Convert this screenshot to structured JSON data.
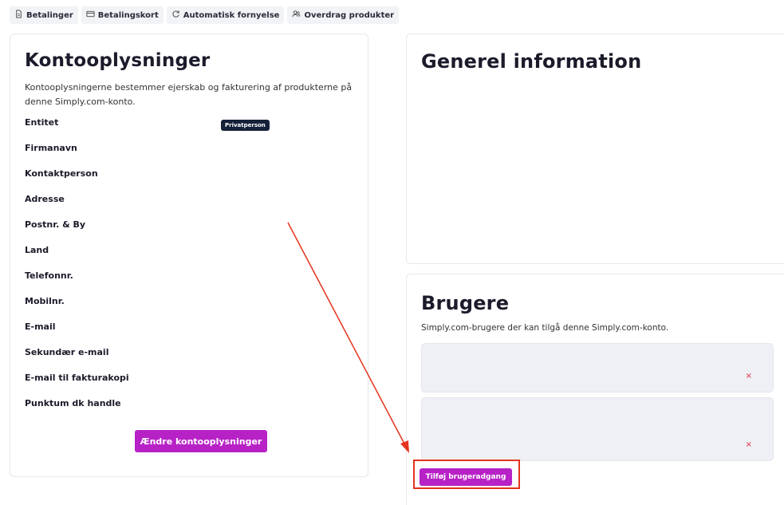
{
  "tabs": [
    {
      "label": "Betalinger",
      "icon": "document-icon"
    },
    {
      "label": "Betalingskort",
      "icon": "credit-card-icon"
    },
    {
      "label": "Automatisk fornyelse",
      "icon": "refresh-icon"
    },
    {
      "label": "Overdrag produkter",
      "icon": "users-icon"
    }
  ],
  "account": {
    "title": "Kontooplysninger",
    "description": "Kontooplysningerne bestemmer ejerskab og fakturering af produkterne på denne Simply.com-konto.",
    "fields": [
      {
        "label": "Entitet",
        "badge": "Privatperson"
      },
      {
        "label": "Firmanavn"
      },
      {
        "label": "Kontaktperson"
      },
      {
        "label": "Adresse"
      },
      {
        "label": "Postnr. & By"
      },
      {
        "label": "Land"
      },
      {
        "label": "Telefonnr."
      },
      {
        "label": "Mobilnr."
      },
      {
        "label": "E-mail"
      },
      {
        "label": "Sekundær e-mail"
      },
      {
        "label": "E-mail til fakturakopi"
      },
      {
        "label": "Punktum dk handle"
      }
    ],
    "edit_button": "Ændre kontooplysninger"
  },
  "general": {
    "title": "Generel information"
  },
  "users": {
    "title": "Brugere",
    "description": "Simply.com-brugere der kan tilgå denne Simply.com-konto.",
    "rows": [
      {
        "remove": "×"
      },
      {
        "remove": "×"
      }
    ],
    "add_button": "Tilføj brugeradgang"
  },
  "colors": {
    "accent": "#b722c6",
    "annotation": "#e5331d",
    "badge": "#15213a"
  }
}
